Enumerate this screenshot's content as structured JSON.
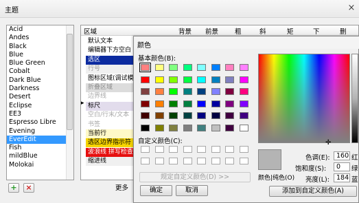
{
  "window": {
    "title": "主题",
    "close_icon": "×"
  },
  "themes": {
    "items": [
      "Acid",
      "Andes",
      "Black",
      "Blue",
      "Blue Green",
      "Cobalt",
      "Dark Blue",
      "Darkness",
      "Desert",
      "Eclipse",
      "EE3",
      "Espresso Libre",
      "Evening",
      "EverEdit",
      "Fish",
      "mildBlue",
      "Molokai"
    ],
    "selected": "EverEdit",
    "add_icon": "+",
    "remove_icon": "×"
  },
  "grid": {
    "columns": [
      "区域",
      "背景",
      "前景",
      "粗",
      "斜",
      "矩",
      "下",
      "删"
    ],
    "rows": [
      {
        "label": "默认文本",
        "bg": "#ffffff",
        "fg": "#000000"
      },
      {
        "label": "编辑器下方空白",
        "bg": "#ffffff",
        "fg": "#000000"
      },
      {
        "label": "选区",
        "bg": "#0c2ba0",
        "fg": "#ffffff"
      },
      {
        "label": "行号",
        "bg": "#f0f0f0",
        "fg": "#9c9c9c"
      },
      {
        "label": "图标区域(调试模式)",
        "bg": "#ffffff",
        "fg": "#000000"
      },
      {
        "label": "折叠区域",
        "bg": "#dcdcdc",
        "fg": "#8c8c8c"
      },
      {
        "label": "边界线",
        "bg": "#ffffff",
        "fg": "#a8a8a8"
      },
      {
        "label": "标尺",
        "bg": "#e2dcec",
        "fg": "#000000"
      },
      {
        "label": "空白/行末/文本",
        "bg": "#ffffff",
        "fg": "#a8a8a8"
      },
      {
        "label": "书签",
        "bg": "#ffffff",
        "fg": "#a8a8a8"
      },
      {
        "label": "当前行",
        "bg": "#fff9c8",
        "fg": "#000000"
      },
      {
        "label": "选区边界指示符",
        "bg": "#f6d400",
        "fg": "#000000"
      },
      {
        "label": "波浪线 拼写检查",
        "bg": "#e61010",
        "fg": "#ffffff"
      },
      {
        "label": "缩进线",
        "bg": "#f0f0f0",
        "fg": "#000000"
      }
    ],
    "row_marker": "▸",
    "more_button": "更多"
  },
  "color_dialog": {
    "title": "颜色",
    "basic_colors_label": "基本颜色(B):",
    "basic_colors": [
      [
        "#ff8080",
        "#ffff80",
        "#80ff80",
        "#00ff80",
        "#80ffff",
        "#0080ff",
        "#ff80c0",
        "#ff80ff"
      ],
      [
        "#ff0000",
        "#ffff00",
        "#80ff00",
        "#00ff40",
        "#00ffff",
        "#0080c0",
        "#8080c0",
        "#ff00ff"
      ],
      [
        "#804040",
        "#ff8040",
        "#00ff00",
        "#008080",
        "#004080",
        "#8080ff",
        "#800040",
        "#ff0080"
      ],
      [
        "#800000",
        "#ff8000",
        "#008000",
        "#008040",
        "#0000ff",
        "#0000a0",
        "#800080",
        "#8000ff"
      ],
      [
        "#400000",
        "#804000",
        "#004000",
        "#004040",
        "#000080",
        "#000040",
        "#400040",
        "#400080"
      ],
      [
        "#000000",
        "#808000",
        "#808040",
        "#808080",
        "#408080",
        "#c0c0c0",
        "#400040",
        "#ffffff"
      ]
    ],
    "selected_swatch": "#ff8080",
    "custom_colors_label": "自定义颜色(C):",
    "custom_colors_rows": 2,
    "custom_colors_cols": 8,
    "define_button": "规定自定义颜色(D) >>",
    "ok_button": "确定",
    "cancel_button": "取消",
    "add_custom_button": "添加到自定义颜色(A)",
    "preview_label": "颜色|纯色(O)",
    "preview_color": "#b4b4b4",
    "crosshair": "✛",
    "hue_label": "色调(E):",
    "hue_value": "160",
    "red_label": "红",
    "sat_label": "饱和度(S):",
    "sat_value": "0",
    "green_label": "绿",
    "lum_label": "亮度(L):",
    "lum_value": "184",
    "blue_label": "蓝"
  }
}
